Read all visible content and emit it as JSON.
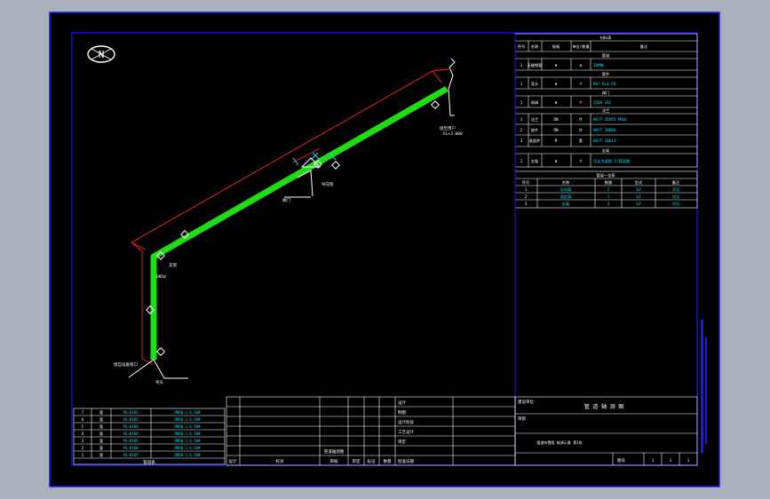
{
  "north_label": "N",
  "material_table": {
    "title": "材料表",
    "headers": [
      "序号",
      "名称",
      "规格",
      "单位/数量",
      "备注"
    ],
    "sections": [
      {
        "name": "管道",
        "rows": [
          [
            "1",
            "无缝钢管",
            "Φ",
            "m",
            "20#钢"
          ]
        ]
      },
      {
        "name": "管件",
        "rows": [
          [
            "1",
            "弯头",
            "Φ",
            "个",
            "90° R=1.5D"
          ]
        ]
      },
      {
        "name": "阀门",
        "rows": [
          [
            "1",
            "闸阀",
            "Φ",
            "个",
            "Z41H-16C"
          ]
        ]
      },
      {
        "name": "法兰",
        "rows": [
          [
            "1",
            "法兰",
            "DN",
            "片",
            "HG/T 20592 PN16"
          ],
          [
            "2",
            "垫片",
            "DN",
            "片",
            "HG/T 20606"
          ],
          [
            "3",
            "紧固件",
            "M",
            "套",
            "HG/T 20613"
          ]
        ]
      },
      {
        "name": "支架",
        "rows": [
          [
            "1",
            "支架",
            "Φ",
            "个",
            "见支吊架图 1/管架图"
          ]
        ]
      }
    ]
  },
  "support_table": {
    "title": "管架一览表",
    "headers": [
      "序号",
      "名称",
      "数量",
      "型式",
      "备注"
    ],
    "rows": [
      [
        "1",
        "导向架",
        "2",
        "GJ",
        "详见"
      ],
      [
        "2",
        "固定架",
        "1",
        "GJ",
        "详见"
      ],
      [
        "3",
        "支架",
        "3",
        "GJ",
        "详见"
      ]
    ]
  },
  "pipe_list": {
    "title": "管道表",
    "rows": [
      [
        "7",
        "管",
        "PG-0101",
        "DN50-1.6-20#"
      ],
      [
        "6",
        "管",
        "PG-0102",
        "DN50-1.6-20#"
      ],
      [
        "5",
        "管",
        "PG-0103",
        "DN50-1.6-20#"
      ],
      [
        "4",
        "管",
        "PG-0104",
        "DN50-1.6-20#"
      ],
      [
        "3",
        "管",
        "PG-0105",
        "DN50-1.6-20#"
      ],
      [
        "2",
        "管",
        "PG-0106",
        "DN50-1.6-20#"
      ],
      [
        "1",
        "管",
        "PG-0107",
        "DN50-1.6-20#"
      ]
    ]
  },
  "title_block": {
    "left_labels": [
      "设计",
      "校对",
      "审核",
      "审定",
      "标记",
      "数量"
    ],
    "sheet_note": "管道轴测图",
    "mid_labels": [
      "设计",
      "制图",
      "设计阶段",
      "工艺设计",
      "审定",
      "批准日期"
    ],
    "company_label": "建设单位",
    "project_label": "项目",
    "drawing_title": "管 道 轴 测 图",
    "drawing_subtitle": "管道布置图 轴测示意 第1张",
    "drawing_no_label": "图号",
    "scale_label": "比例",
    "sheet_values": [
      "1",
      "1",
      "1"
    ]
  },
  "pipe_labels": {
    "start": "接自设备管口",
    "end": "接至用户",
    "elev": "EL+3.000",
    "dn": "DN50",
    "support": "支架",
    "support2": "导向架",
    "valve": "阀门",
    "corner": "弯头"
  },
  "colors": {
    "background_outer": "#a9b1bb",
    "canvas": "#000000",
    "frame": "#1717ff",
    "pipe": "#1fdc14",
    "dim": "#ff2020",
    "table_line": "#ffffff",
    "cyan_text": "#00e5ff"
  }
}
